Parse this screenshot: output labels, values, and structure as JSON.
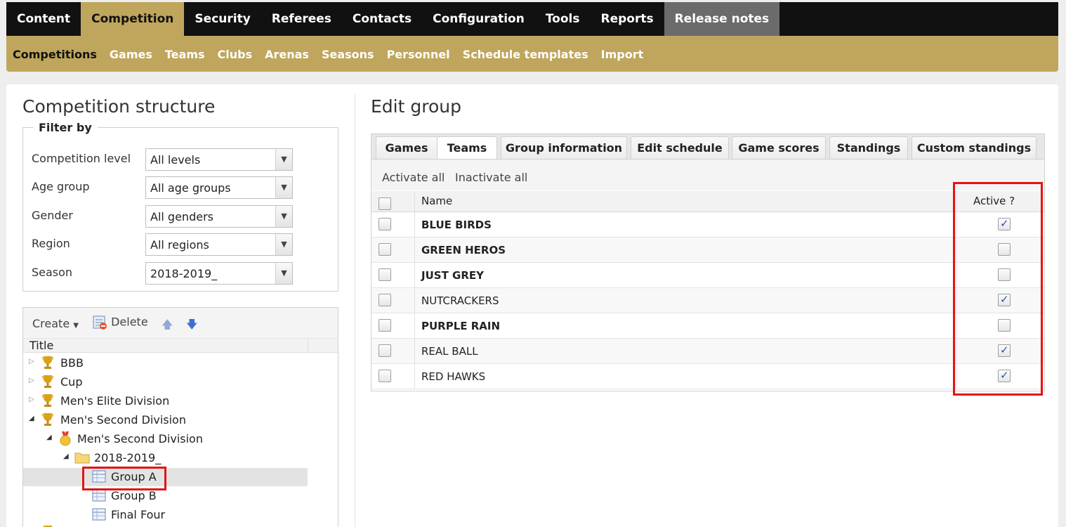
{
  "topnav": [
    {
      "label": "Content"
    },
    {
      "label": "Competition"
    },
    {
      "label": "Security"
    },
    {
      "label": "Referees"
    },
    {
      "label": "Contacts"
    },
    {
      "label": "Configuration"
    },
    {
      "label": "Tools"
    },
    {
      "label": "Reports"
    },
    {
      "label": "Release notes"
    }
  ],
  "subnav": [
    {
      "label": "Competitions"
    },
    {
      "label": "Games"
    },
    {
      "label": "Teams"
    },
    {
      "label": "Clubs"
    },
    {
      "label": "Arenas"
    },
    {
      "label": "Seasons"
    },
    {
      "label": "Personnel"
    },
    {
      "label": "Schedule templates"
    },
    {
      "label": "Import"
    }
  ],
  "left": {
    "title": "Competition structure",
    "filter": {
      "legend": "Filter by",
      "rows": [
        {
          "label": "Competition level",
          "value": "All levels"
        },
        {
          "label": "Age group",
          "value": "All age groups"
        },
        {
          "label": "Gender",
          "value": "All genders"
        },
        {
          "label": "Region",
          "value": "All regions"
        },
        {
          "label": "Season",
          "value": "2018-2019_"
        }
      ]
    },
    "tree": {
      "create_label": "Create",
      "delete_label": "Delete",
      "column_title": "Title",
      "nodes": [
        {
          "label": "BBB"
        },
        {
          "label": "Cup"
        },
        {
          "label": "Men's Elite Division"
        },
        {
          "label": "Men's Second Division"
        },
        {
          "label": "Men's Second Division"
        },
        {
          "label": "2018-2019_"
        },
        {
          "label": "Group A"
        },
        {
          "label": "Group B"
        },
        {
          "label": "Final Four"
        }
      ]
    }
  },
  "right": {
    "title": "Edit group",
    "tabs": [
      {
        "label": "Games"
      },
      {
        "label": "Teams"
      },
      {
        "label": "Group information"
      },
      {
        "label": "Edit schedule"
      },
      {
        "label": "Game scores"
      },
      {
        "label": "Standings"
      },
      {
        "label": "Custom standings"
      }
    ],
    "toolbar": {
      "activate_all": "Activate all",
      "inactivate_all": "Inactivate all"
    },
    "columns": {
      "name": "Name",
      "active": "Active ?"
    },
    "rows": [
      {
        "name": "BLUE BIRDS",
        "active": true
      },
      {
        "name": "GREEN HEROS",
        "active": false
      },
      {
        "name": "JUST GREY",
        "active": false
      },
      {
        "name": "NUTCRACKERS",
        "active": true
      },
      {
        "name": "PURPLE RAIN",
        "active": false
      },
      {
        "name": "REAL BALL",
        "active": true
      },
      {
        "name": "RED HAWKS",
        "active": true
      }
    ]
  },
  "colors": {
    "gold": "#bfa65c",
    "black": "#111111",
    "highlight": "#e41313"
  }
}
